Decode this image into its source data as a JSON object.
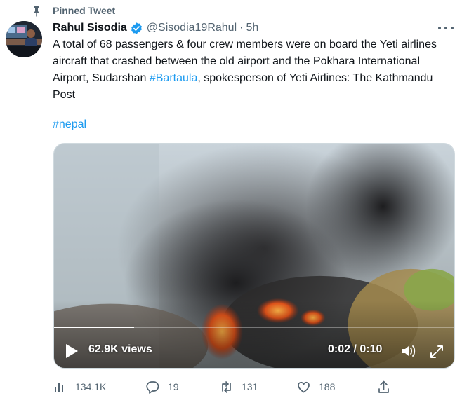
{
  "pinned": {
    "label": "Pinned Tweet"
  },
  "author": {
    "name": "Rahul Sisodia",
    "handle": "@Sisodia19Rahul",
    "separator": "·",
    "time": "5h"
  },
  "tweet": {
    "text_before": "A total of 68 passengers & four crew members were on board the Yeti airlines aircraft that crashed between the old airport and the Pokhara International Airport, Sudarshan ",
    "mention_hashtag": "#Bartaula",
    "text_after": ", spokesperson of Yeti Airlines: The Kathmandu Post",
    "hashtag": "#nepal"
  },
  "video": {
    "views": "62.9K views",
    "timecode": "0:02 / 0:10",
    "progress": 0.2
  },
  "actions": {
    "views": "134.1K",
    "replies": "19",
    "retweets": "131",
    "likes": "188"
  },
  "colors": {
    "accent": "#1d9bf0",
    "secondary_text": "#536471",
    "primary_text": "#0f1419"
  },
  "icons": [
    "pin-icon",
    "verified-icon",
    "more-icon",
    "play-icon",
    "volume-icon",
    "fullscreen-icon",
    "analytics-icon",
    "reply-icon",
    "retweet-icon",
    "like-icon",
    "share-icon"
  ]
}
